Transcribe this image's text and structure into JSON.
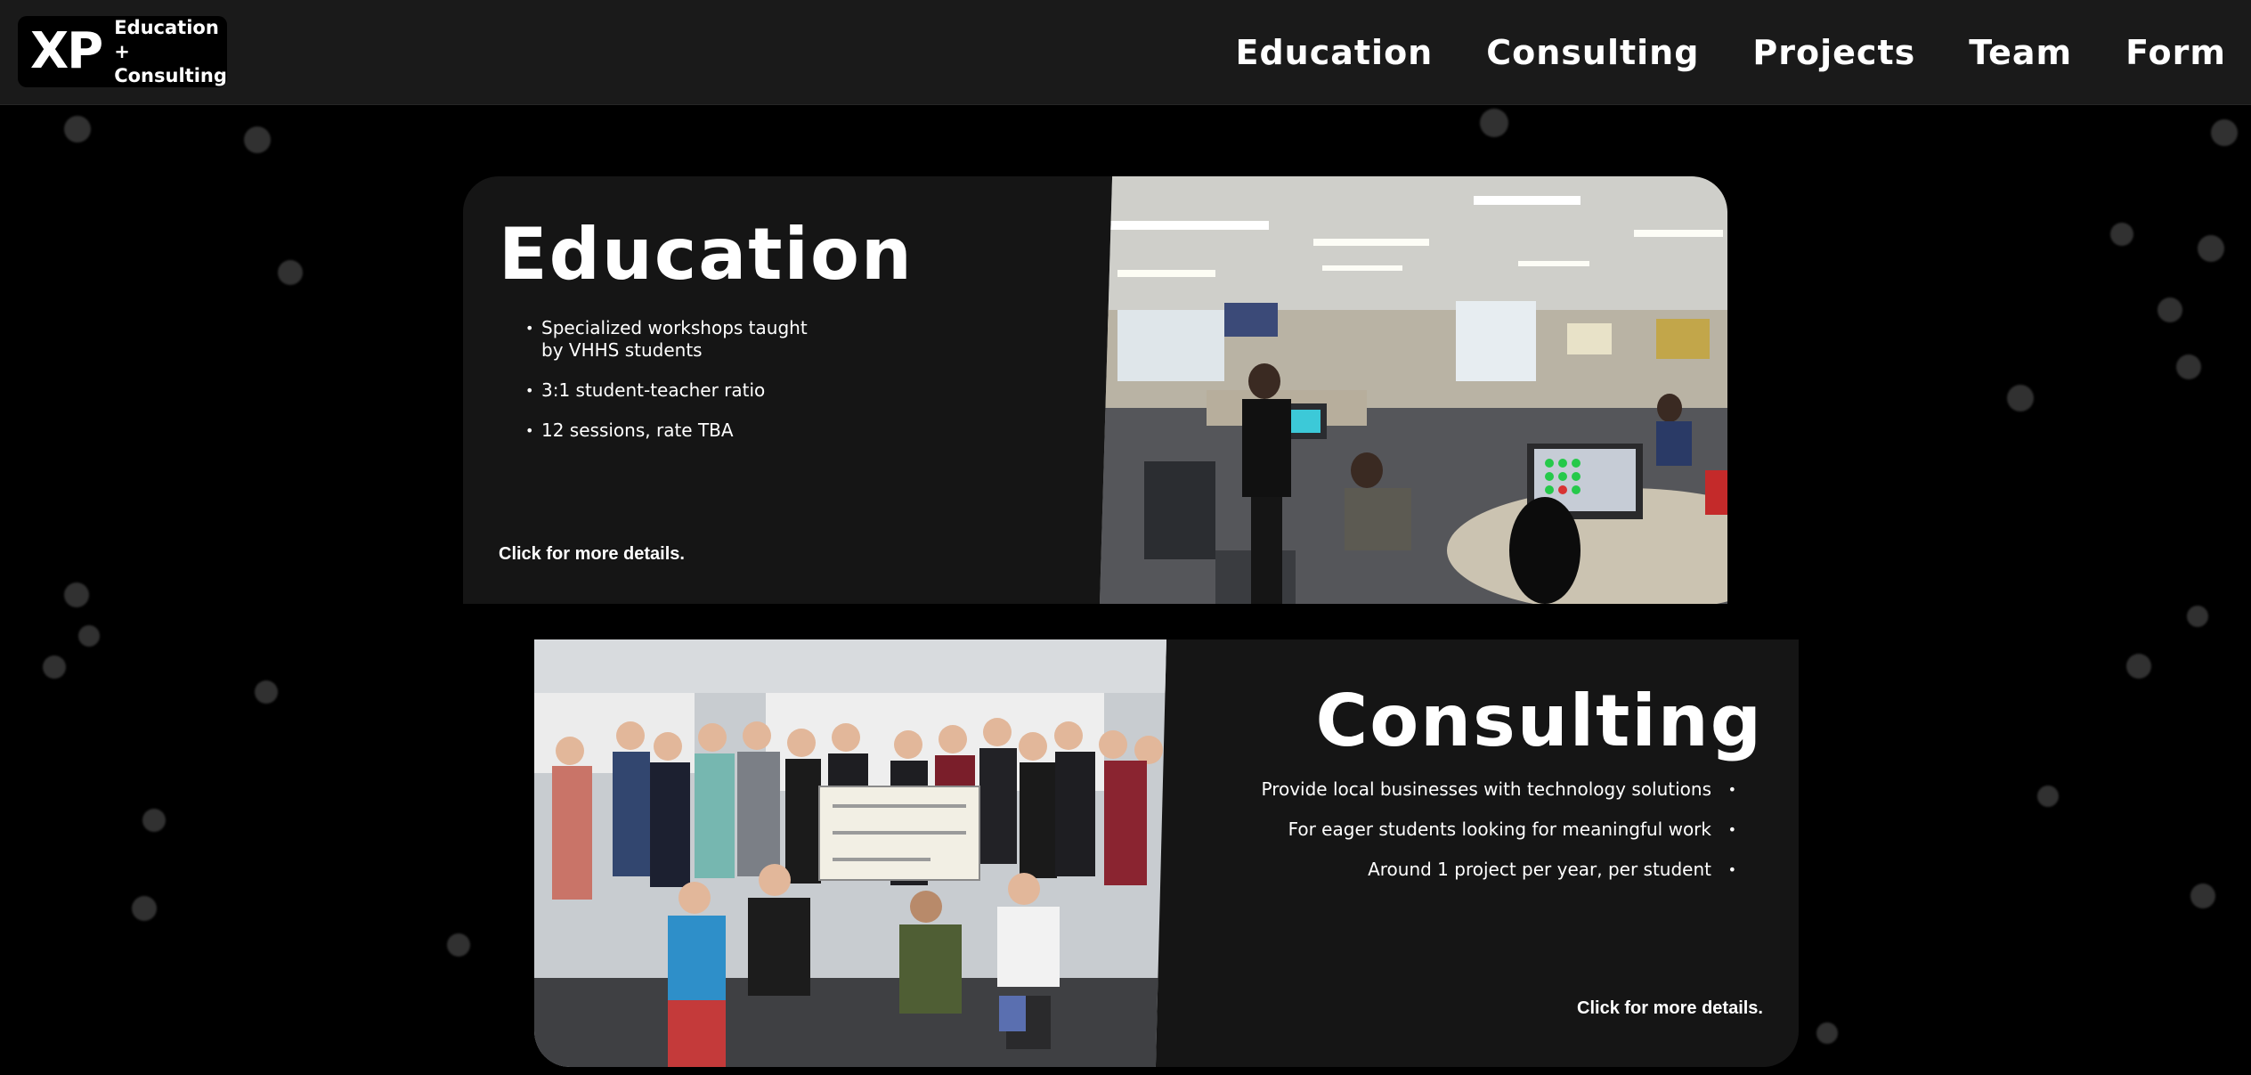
{
  "header": {
    "logo_mark": "XP",
    "logo_line1": "Education +",
    "logo_line2": "Consulting",
    "nav": [
      "Education",
      "Consulting",
      "Projects",
      "Team",
      "Form"
    ]
  },
  "education": {
    "title": "Education",
    "bullets": [
      "Specialized workshops taught by VHHS students",
      "3:1 student-teacher ratio",
      "12 sessions, rate TBA"
    ],
    "more": "Click for more details."
  },
  "consulting": {
    "title": "Consulting",
    "bullets": [
      "Provide local businesses with technology solutions",
      "For eager students looking for meaningful work",
      "Around 1 project per year, per student"
    ],
    "more": "Click for more details."
  },
  "colors": {
    "background": "#000000",
    "header": "#1a1a1a",
    "card": "#151515",
    "text": "#ffffff"
  }
}
